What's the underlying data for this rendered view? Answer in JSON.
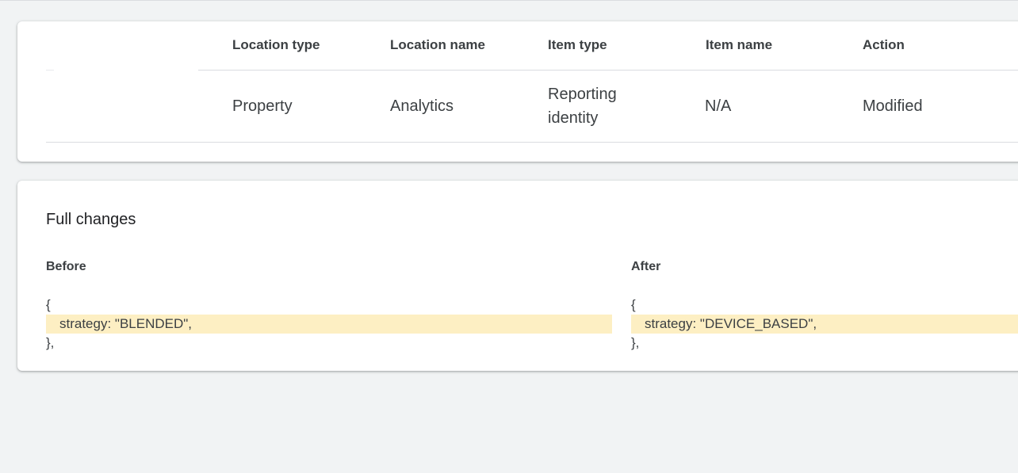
{
  "table": {
    "headers": [
      "Location type",
      "Location name",
      "Item type",
      "Item name",
      "Action"
    ],
    "row": {
      "location_type": "Property",
      "location_name": "Analytics",
      "item_type_line1": "Reporting",
      "item_type_line2": "identity",
      "item_name": "N/A",
      "action": "Modified"
    }
  },
  "changes": {
    "title": "Full changes",
    "before": {
      "label": "Before",
      "open": "{",
      "line": "strategy: \"BLENDED\",",
      "close": "},"
    },
    "after": {
      "label": "After",
      "open": "{",
      "line": "strategy: \"DEVICE_BASED\",",
      "close": "},"
    }
  },
  "colors": {
    "background": "#f1f3f4",
    "card": "#ffffff",
    "highlight": "#fdefc3",
    "text": "#3c4043",
    "divider": "#dadce0"
  }
}
